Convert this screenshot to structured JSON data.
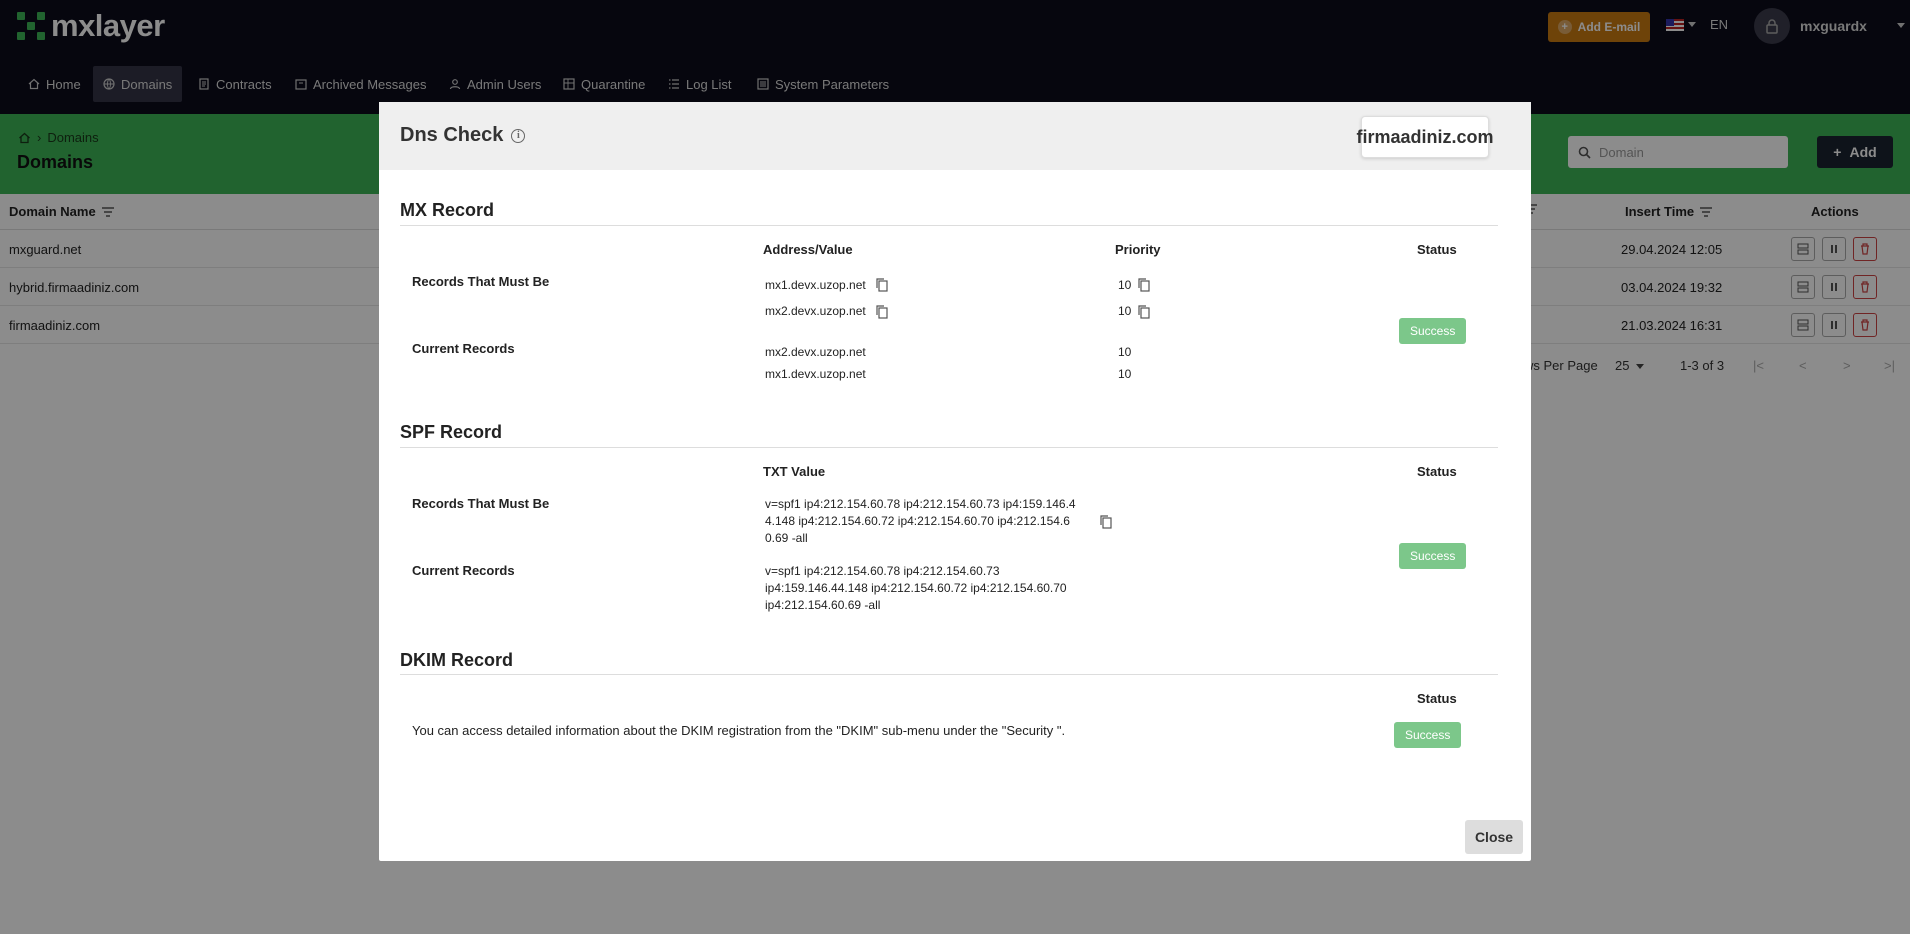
{
  "app": {
    "name": "mxlayer"
  },
  "colors": {
    "brand_green": "#3cb457",
    "accent_orange": "#c97a12",
    "success": "#7cc78a",
    "topbar": "#0b0b1a"
  },
  "topbar": {
    "add_email_label": "Add E-mail",
    "language": "EN",
    "username": "mxguardx"
  },
  "nav": [
    {
      "label": "Home",
      "icon": "home-icon"
    },
    {
      "label": "Domains",
      "icon": "globe-icon"
    },
    {
      "label": "Contracts",
      "icon": "document-icon"
    },
    {
      "label": "Archived Messages",
      "icon": "archive-icon"
    },
    {
      "label": "Admin Users",
      "icon": "user-icon"
    },
    {
      "label": "Quarantine",
      "icon": "quarantine-icon"
    },
    {
      "label": "Log List",
      "icon": "list-icon"
    },
    {
      "label": "System Parameters",
      "icon": "settings-icon"
    }
  ],
  "page": {
    "breadcrumb": "Domains",
    "title": "Domains",
    "search_placeholder": "Domain",
    "add_label": "Add"
  },
  "table": {
    "headers": {
      "domain_name": "Domain Name",
      "insert_time": "Insert Time",
      "actions": "Actions"
    },
    "rows": [
      {
        "domain": "mxguard.net",
        "insert_time": "29.04.2024 12:05"
      },
      {
        "domain": "hybrid.firmaadiniz.com",
        "insert_time": "03.04.2024 19:32"
      },
      {
        "domain": "firmaadiniz.com",
        "insert_time": "21.03.2024 16:31"
      }
    ],
    "rows_per_page_label": "ws Per Page",
    "rows_per_page": "25",
    "range": "1-3 of 3"
  },
  "modal": {
    "title": "Dns Check",
    "domain": "firmaadiniz.com",
    "close_label": "Close",
    "mx": {
      "title": "MX Record",
      "col_address": "Address/Value",
      "col_priority": "Priority",
      "col_status": "Status",
      "must_label": "Records That Must Be",
      "current_label": "Current Records",
      "must": [
        {
          "address": "mx1.devx.uzop.net",
          "priority": "10"
        },
        {
          "address": "mx2.devx.uzop.net",
          "priority": "10"
        }
      ],
      "current": [
        {
          "address": "mx2.devx.uzop.net",
          "priority": "10"
        },
        {
          "address": "mx1.devx.uzop.net",
          "priority": "10"
        }
      ],
      "status": "Success"
    },
    "spf": {
      "title": "SPF Record",
      "col_txt": "TXT Value",
      "col_status": "Status",
      "must_label": "Records That Must Be",
      "current_label": "Current Records",
      "must_lines": [
        "v=spf1 ip4:212.154.60.78 ip4:212.154.60.73 ip4:159.146.4",
        "4.148 ip4:212.154.60.72 ip4:212.154.60.70 ip4:212.154.6",
        "0.69 -all"
      ],
      "current_lines": [
        "v=spf1 ip4:212.154.60.78 ip4:212.154.60.73",
        "ip4:159.146.44.148 ip4:212.154.60.72 ip4:212.154.60.70",
        "ip4:212.154.60.69 -all"
      ],
      "status": "Success"
    },
    "dkim": {
      "title": "DKIM Record",
      "col_status": "Status",
      "message": "You can access detailed information about the DKIM registration from the \"DKIM\" sub-menu under the \"Security \".",
      "status": "Success"
    }
  }
}
